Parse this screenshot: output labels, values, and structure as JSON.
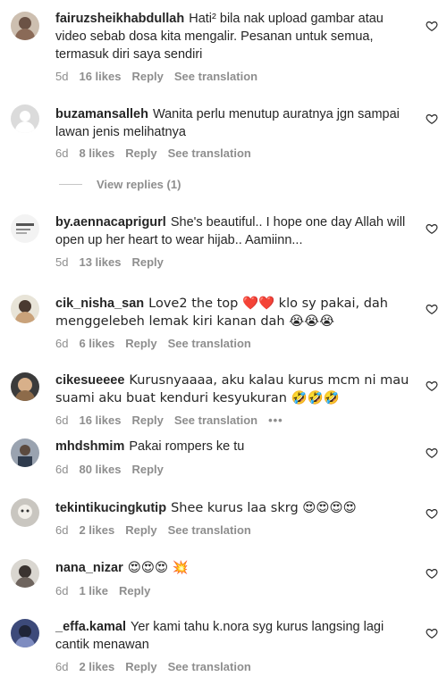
{
  "comments": [
    {
      "username": "fairuzsheikhabdullah",
      "text": "Hati² bila nak upload gambar atau video sebab dosa kita mengalir. Pesanan untuk semua, termasuk diri saya sendiri",
      "time": "5d",
      "likes": "16 likes",
      "reply": "Reply",
      "translation": "See translation"
    },
    {
      "username": "buzamansalleh",
      "text": "Wanita perlu menutup auratnya jgn sampai lawan jenis melihatnya",
      "time": "6d",
      "likes": "8 likes",
      "reply": "Reply",
      "translation": "See translation",
      "view_replies": "View replies (1)"
    },
    {
      "username": "by.aennacaprigurl",
      "text": "She's beautiful.. I hope one day Allah will open up her heart to wear hijab.. Aamiinn...",
      "time": "5d",
      "likes": "13 likes",
      "reply": "Reply"
    },
    {
      "username": "cik_nisha_san",
      "text": "Love2 the top ❤️❤️ klo sy pakai, dah menggelebeh lemak kiri kanan dah 😭😭😭",
      "time": "6d",
      "likes": "6 likes",
      "reply": "Reply",
      "translation": "See translation"
    },
    {
      "username": "cikesueeee",
      "text": "Kurusnyaaaa, aku kalau kurus mcm ni mau suami aku buat kenduri kesyukuran 🤣🤣🤣",
      "time": "6d",
      "likes": "16 likes",
      "reply": "Reply",
      "translation": "See translation",
      "more": "•••"
    },
    {
      "username": "mhdshmim",
      "text": "Pakai rompers ke tu",
      "time": "6d",
      "likes": "80 likes",
      "reply": "Reply"
    },
    {
      "username": "tekintikucingkutip",
      "text": "Shee kurus laa skrg 😍😍😍😍",
      "time": "6d",
      "likes": "2 likes",
      "reply": "Reply",
      "translation": "See translation"
    },
    {
      "username": "nana_nizar",
      "text": "😍😍😍 💥",
      "time": "6d",
      "likes": "1 like",
      "reply": "Reply"
    },
    {
      "username": "_effa.kamal",
      "text": "Yer kami tahu k.nora syg kurus langsing lagi cantik menawan",
      "time": "6d",
      "likes": "2 likes",
      "reply": "Reply",
      "translation": "See translation"
    }
  ],
  "icons": {
    "like": "heart-outline-icon"
  },
  "colors": {
    "meta": "#8e8e8e",
    "text": "#262626"
  }
}
